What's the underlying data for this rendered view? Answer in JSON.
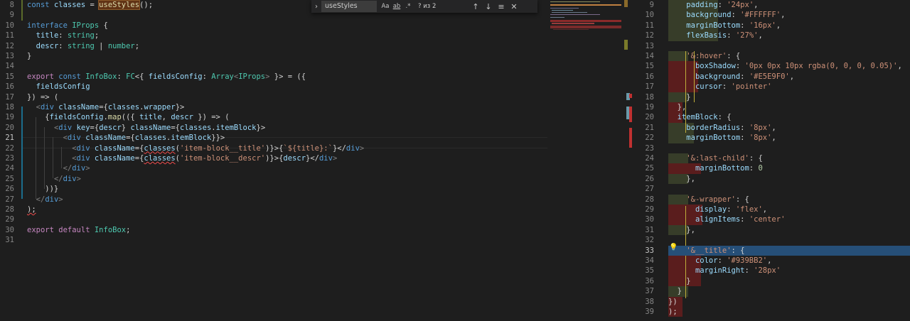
{
  "find": {
    "query": "useStyles",
    "match_case": "Aa",
    "whole_word": "ab",
    "regex": ".*",
    "count": "? из 2",
    "up": "↑",
    "down": "↓",
    "selection": "≡",
    "close": "✕"
  },
  "left": {
    "active_line": "21",
    "lines": [
      {
        "n": "8",
        "code": "const classes = useStyles();"
      },
      {
        "n": "9",
        "code": ""
      },
      {
        "n": "10",
        "code": "interface IProps {"
      },
      {
        "n": "11",
        "code": "  title: string;"
      },
      {
        "n": "12",
        "code": "  descr: string | number;"
      },
      {
        "n": "13",
        "code": "}"
      },
      {
        "n": "14",
        "code": ""
      },
      {
        "n": "15",
        "code": "export const InfoBox: FC<{ fieldsConfig: Array<IProps> }> = ({"
      },
      {
        "n": "16",
        "code": "  fieldsConfig"
      },
      {
        "n": "17",
        "code": "}) => ("
      },
      {
        "n": "18",
        "code": "  <div className={classes.wrapper}>"
      },
      {
        "n": "19",
        "code": "    {fieldsConfig.map(({ title, descr }) => ("
      },
      {
        "n": "20",
        "code": "      <div key={descr} className={classes.itemBlock}>"
      },
      {
        "n": "21",
        "code": "        <div className={classes.itemBlock}}>"
      },
      {
        "n": "22",
        "code": "          <div className={classes('item-block__title')}>{`${title}:`}</div>"
      },
      {
        "n": "23",
        "code": "          <div className={classes('item-block__descr')}>{descr}</div>"
      },
      {
        "n": "24",
        "code": "        </div>"
      },
      {
        "n": "25",
        "code": "      </div>"
      },
      {
        "n": "26",
        "code": "    ))}"
      },
      {
        "n": "27",
        "code": "  </div>"
      },
      {
        "n": "28",
        "code": ");"
      },
      {
        "n": "29",
        "code": ""
      },
      {
        "n": "30",
        "code": "export default InfoBox;"
      },
      {
        "n": "31",
        "code": ""
      }
    ]
  },
  "right": {
    "active_line": "33",
    "lines": [
      {
        "n": "9",
        "code": "    padding: '24px',"
      },
      {
        "n": "10",
        "code": "    background: '#FFFFFF',"
      },
      {
        "n": "11",
        "code": "    marginBottom: '16px',"
      },
      {
        "n": "12",
        "code": "    flexBasis: '27%',"
      },
      {
        "n": "13",
        "code": ""
      },
      {
        "n": "14",
        "code": "    '&:hover': {"
      },
      {
        "n": "15",
        "code": "      boxShadow: '0px 0px 10px rgba(0, 0, 0, 0.05)',"
      },
      {
        "n": "16",
        "code": "      background: '#E5E9F0',"
      },
      {
        "n": "17",
        "code": "      cursor: 'pointer'"
      },
      {
        "n": "18",
        "code": "    }"
      },
      {
        "n": "19",
        "code": "  },"
      },
      {
        "n": "20",
        "code": "  itemBlock: {"
      },
      {
        "n": "21",
        "code": "    borderRadius: '8px',"
      },
      {
        "n": "22",
        "code": "    marginBottom: '8px',"
      },
      {
        "n": "23",
        "code": ""
      },
      {
        "n": "24",
        "code": "    '&:last-child': {"
      },
      {
        "n": "25",
        "code": "      marginBottom: 0"
      },
      {
        "n": "26",
        "code": "    },"
      },
      {
        "n": "27",
        "code": ""
      },
      {
        "n": "28",
        "code": "    '&-wrapper': {"
      },
      {
        "n": "29",
        "code": "      display: 'flex',"
      },
      {
        "n": "30",
        "code": "      alignItems: 'center'"
      },
      {
        "n": "31",
        "code": "    },"
      },
      {
        "n": "32",
        "code": ""
      },
      {
        "n": "33",
        "code": "    '&__title': {"
      },
      {
        "n": "34",
        "code": "      color: '#939BB2',"
      },
      {
        "n": "35",
        "code": "      marginRight: '28px'"
      },
      {
        "n": "36",
        "code": "    }"
      },
      {
        "n": "37",
        "code": "  }"
      },
      {
        "n": "38",
        "code": "})"
      },
      {
        "n": "39",
        "code": ");"
      }
    ]
  },
  "colors": {
    "background": "#1e1e1e",
    "keyword": "#569cd6",
    "control": "#c586c0",
    "variable": "#9cdcfe",
    "function": "#dcdcaa",
    "type": "#4ec9b0",
    "string": "#ce9178",
    "number": "#b5cea8",
    "diff_removed": "#5a1d1d",
    "diff_changed": "#373d29",
    "find_highlight": "#613315"
  }
}
